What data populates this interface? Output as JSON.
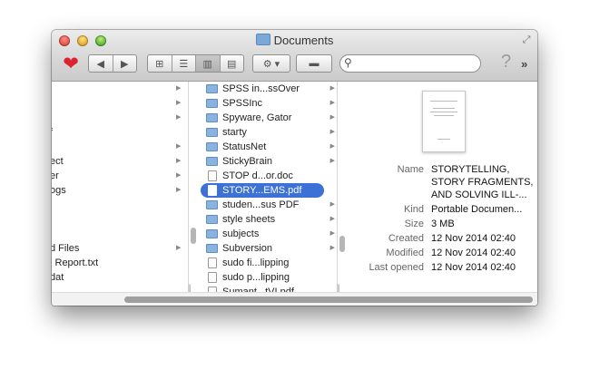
{
  "window": {
    "title": "Documents"
  },
  "toolbar": {
    "back_label": "◀",
    "forward_label": "▶",
    "views": [
      "icon-view",
      "list-view",
      "column-view",
      "coverflow-view"
    ],
    "active_view": "column-view",
    "action_label": "⚙ ▾",
    "tag_label": "▬",
    "search_placeholder": "",
    "help_label": "?",
    "more_label": "»"
  },
  "column1": {
    "items": [
      {
        "label": "",
        "arrow": true
      },
      {
        "label": "",
        "arrow": true
      },
      {
        "label": "",
        "arrow": true
      },
      {
        "label": "f",
        "arrow": false
      },
      {
        "label": "",
        "arrow": true
      },
      {
        "label": "ect",
        "arrow": true
      },
      {
        "label": "er",
        "arrow": true
      },
      {
        "label": "ogs",
        "arrow": true
      },
      {
        "label": "",
        "arrow": false
      },
      {
        "label": "",
        "arrow": false
      },
      {
        "label": "",
        "arrow": false
      },
      {
        "label": "d Files",
        "arrow": true
      },
      {
        "label": "l Report.txt",
        "arrow": false
      },
      {
        "label": "dat",
        "arrow": false
      }
    ]
  },
  "column2": {
    "items": [
      {
        "label": "SPSS in...ssOver",
        "kind": "folder",
        "arrow": true
      },
      {
        "label": "SPSSInc",
        "kind": "folder",
        "arrow": true
      },
      {
        "label": "Spyware, Gator",
        "kind": "folder",
        "arrow": true
      },
      {
        "label": "starty",
        "kind": "folder",
        "arrow": true
      },
      {
        "label": "StatusNet",
        "kind": "folder",
        "arrow": true
      },
      {
        "label": "StickyBrain",
        "kind": "folder",
        "arrow": true
      },
      {
        "label": "STOP d...or.doc",
        "kind": "doc",
        "arrow": false
      },
      {
        "label": "STORY...EMS.pdf",
        "kind": "doc",
        "arrow": false,
        "selected": true
      },
      {
        "label": "studen...sus PDF",
        "kind": "folder",
        "arrow": true
      },
      {
        "label": "style sheets",
        "kind": "folder",
        "arrow": true
      },
      {
        "label": "subjects",
        "kind": "folder",
        "arrow": true
      },
      {
        "label": "Subversion",
        "kind": "folder",
        "arrow": true
      },
      {
        "label": "sudo fi...lipping",
        "kind": "doc",
        "arrow": false
      },
      {
        "label": "sudo p...lipping",
        "kind": "doc",
        "arrow": false
      },
      {
        "label": "Sumant...tVI.pdf",
        "kind": "doc",
        "arrow": false
      }
    ]
  },
  "preview": {
    "fields": [
      {
        "label": "Name",
        "value": [
          "STORYTELLING,",
          "STORY FRAGMENTS,",
          "AND SOLVING ILL-..."
        ]
      },
      {
        "label": "Kind",
        "value": [
          "Portable Documen..."
        ]
      },
      {
        "label": "Size",
        "value": [
          "3 MB"
        ]
      },
      {
        "label": "Created",
        "value": [
          "12 Nov 2014 02:40"
        ]
      },
      {
        "label": "Modified",
        "value": [
          "12 Nov 2014 02:40"
        ]
      },
      {
        "label": "Last opened",
        "value": [
          "12 Nov 2014 02:40"
        ]
      }
    ]
  },
  "colors": {
    "selection": "#3c72d6",
    "folder": "#8ab4df",
    "heart": "#dd2231"
  }
}
